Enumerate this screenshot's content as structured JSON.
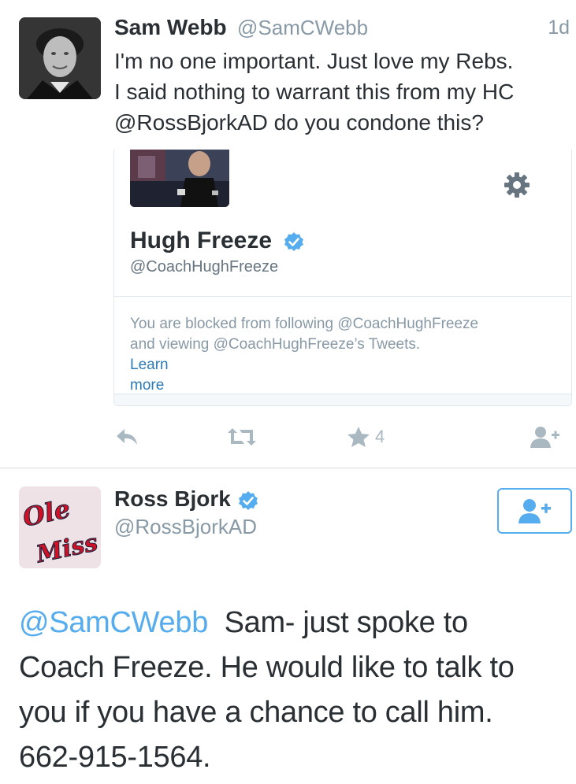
{
  "tweet1": {
    "author_name": "Sam Webb",
    "author_handle": "@SamCWebb",
    "time": "1d",
    "text_lines": [
      "I'm no one important. Just love my Rebs.",
      "I said nothing to warrant this from my HC",
      "@RossBjorkAD do you condone this?"
    ],
    "card": {
      "name": "Hugh Freeze",
      "handle": "@CoachHughFreeze",
      "blocked_lines": [
        "You are blocked from following @CoachHughFreeze",
        "and viewing @CoachHughFreeze’s Tweets.",
        "more"
      ],
      "learn_label": "Learn"
    },
    "favorite_count": "4"
  },
  "tweet2": {
    "author_name": "Ross Bjork",
    "author_handle": "@RossBjorkAD",
    "avatar_logo_lines": [
      "Ole",
      "Miss"
    ],
    "mention": "@SamCWebb",
    "text_first": "Sam- just spoke to",
    "text_lines": [
      "Coach Freeze. He would like to talk to",
      "you if you have a chance to call him.",
      "662-915-1564."
    ]
  },
  "colors": {
    "link_blue": "#55acee",
    "learn_blue": "#2b7bb9",
    "muted_gray": "#8899a6",
    "text_dark": "#292f33",
    "ole_miss_red": "#ce1126"
  },
  "icons": [
    "reply-icon",
    "retweet-icon",
    "favorite-icon",
    "follow-icon",
    "gear-icon",
    "verified-badge-icon"
  ]
}
